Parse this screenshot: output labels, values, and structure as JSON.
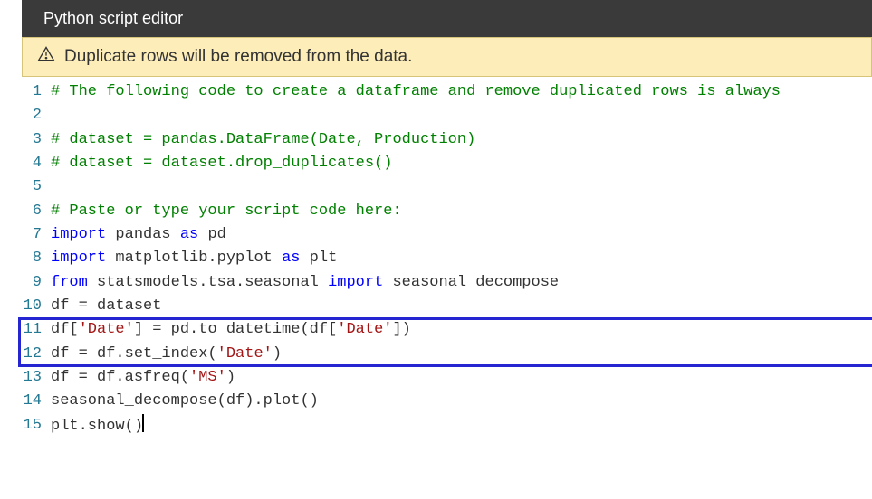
{
  "header": {
    "title": "Python script editor"
  },
  "warning": {
    "text": "Duplicate rows will be removed from the data."
  },
  "code": {
    "lines": [
      {
        "n": 1,
        "tokens": [
          {
            "cls": "c-comment",
            "t": "# The following code to create a dataframe and remove duplicated rows is always"
          }
        ]
      },
      {
        "n": 2,
        "tokens": []
      },
      {
        "n": 3,
        "tokens": [
          {
            "cls": "c-comment",
            "t": "# dataset = pandas.DataFrame(Date, Production)"
          }
        ]
      },
      {
        "n": 4,
        "tokens": [
          {
            "cls": "c-comment",
            "t": "# dataset = dataset.drop_duplicates()"
          }
        ]
      },
      {
        "n": 5,
        "tokens": []
      },
      {
        "n": 6,
        "tokens": [
          {
            "cls": "c-comment",
            "t": "# Paste or type your script code here:"
          }
        ]
      },
      {
        "n": 7,
        "tokens": [
          {
            "cls": "c-keyword",
            "t": "import"
          },
          {
            "cls": "c-text",
            "t": " pandas "
          },
          {
            "cls": "c-keyword",
            "t": "as"
          },
          {
            "cls": "c-text",
            "t": " pd"
          }
        ]
      },
      {
        "n": 8,
        "tokens": [
          {
            "cls": "c-keyword",
            "t": "import"
          },
          {
            "cls": "c-text",
            "t": " matplotlib.pyplot "
          },
          {
            "cls": "c-keyword",
            "t": "as"
          },
          {
            "cls": "c-text",
            "t": " plt"
          }
        ]
      },
      {
        "n": 9,
        "tokens": [
          {
            "cls": "c-keyword",
            "t": "from"
          },
          {
            "cls": "c-text",
            "t": " statsmodels.tsa.seasonal "
          },
          {
            "cls": "c-keyword",
            "t": "import"
          },
          {
            "cls": "c-text",
            "t": " seasonal_decompose"
          }
        ]
      },
      {
        "n": 10,
        "tokens": [
          {
            "cls": "c-text",
            "t": "df = dataset"
          }
        ]
      },
      {
        "n": 11,
        "tokens": [
          {
            "cls": "c-text",
            "t": "df["
          },
          {
            "cls": "c-string",
            "t": "'Date'"
          },
          {
            "cls": "c-text",
            "t": "] = pd.to_datetime(df["
          },
          {
            "cls": "c-string",
            "t": "'Date'"
          },
          {
            "cls": "c-text",
            "t": "])"
          }
        ]
      },
      {
        "n": 12,
        "tokens": [
          {
            "cls": "c-text",
            "t": "df = df.set_index("
          },
          {
            "cls": "c-string",
            "t": "'Date'"
          },
          {
            "cls": "c-text",
            "t": ")"
          }
        ]
      },
      {
        "n": 13,
        "tokens": [
          {
            "cls": "c-text",
            "t": "df = df.asfreq("
          },
          {
            "cls": "c-string",
            "t": "'MS'"
          },
          {
            "cls": "c-text",
            "t": ")"
          }
        ]
      },
      {
        "n": 14,
        "tokens": [
          {
            "cls": "c-text",
            "t": "seasonal_decompose(df).plot()"
          }
        ]
      },
      {
        "n": 15,
        "tokens": [
          {
            "cls": "c-text",
            "t": "plt.show()"
          }
        ]
      }
    ]
  },
  "highlight": {
    "fromLine": 11,
    "toLine": 12
  },
  "cursor": {
    "line": 15
  }
}
